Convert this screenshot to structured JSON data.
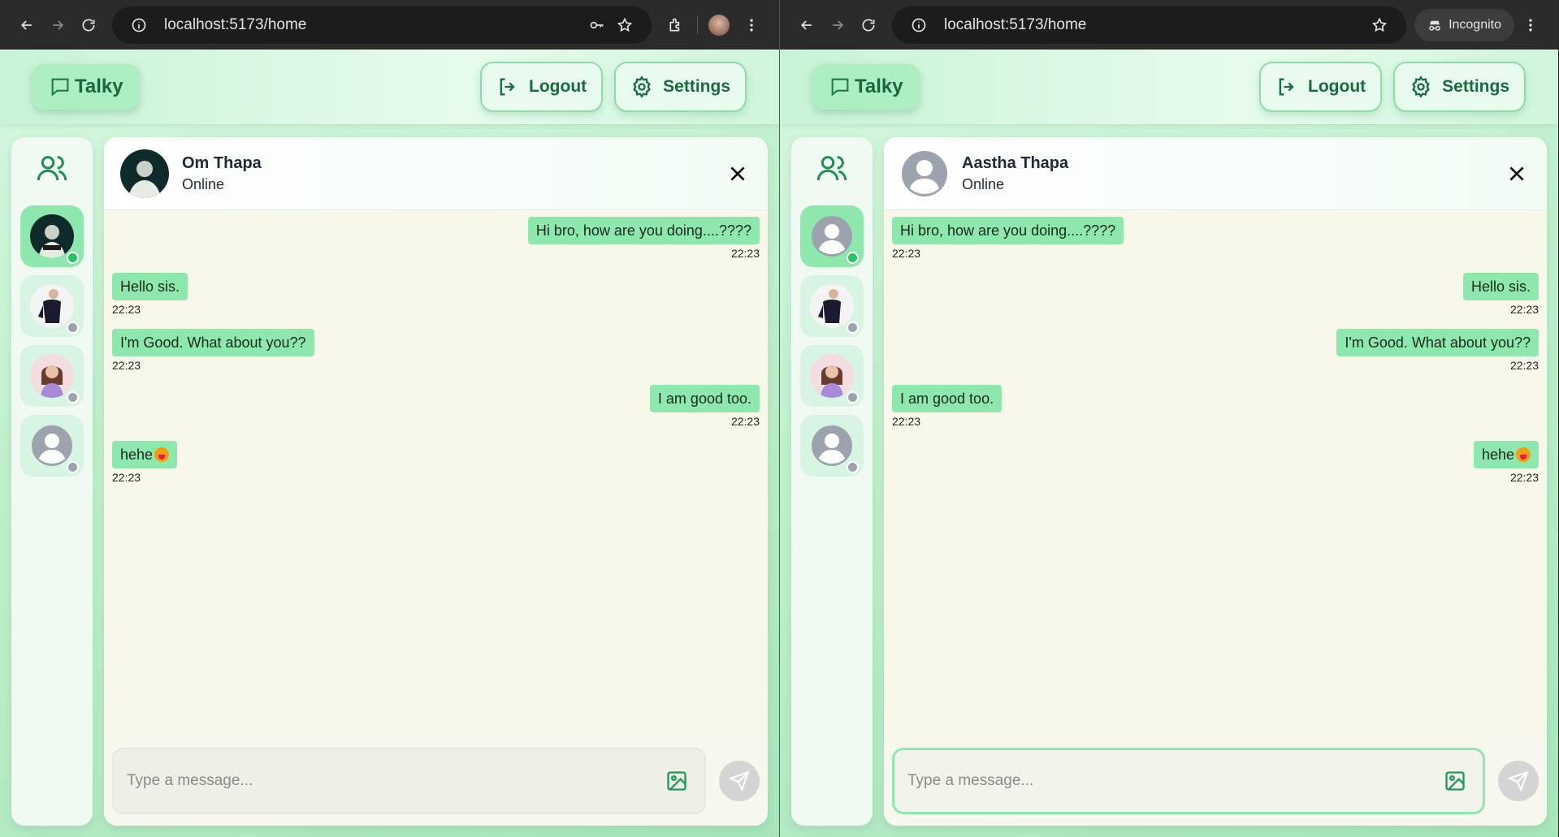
{
  "windows": [
    {
      "browser": {
        "url": "localhost:5173/home"
      },
      "app": {
        "brand": "Talky",
        "logout_label": "Logout",
        "settings_label": "Settings",
        "chat": {
          "name": "Om Thapa",
          "status": "Online"
        },
        "composer": {
          "placeholder": "Type a message..."
        },
        "messages": [
          {
            "side": "right",
            "text": "Hi bro, how are you doing....????",
            "time": "22:23"
          },
          {
            "side": "left",
            "text": "Hello sis.",
            "time": "22:23"
          },
          {
            "side": "left",
            "text": "I'm Good. What about you??",
            "time": "22:23"
          },
          {
            "side": "right",
            "text": "I am good too.",
            "time": "22:23"
          },
          {
            "side": "left",
            "text": "hehe",
            "time": "22:23",
            "emoji": true
          }
        ]
      }
    },
    {
      "browser": {
        "url": "localhost:5173/home",
        "incognito_label": "Incognito"
      },
      "app": {
        "brand": "Talky",
        "logout_label": "Logout",
        "settings_label": "Settings",
        "chat": {
          "name": "Aastha Thapa",
          "status": "Online"
        },
        "composer": {
          "placeholder": "Type a message..."
        },
        "messages": [
          {
            "side": "left",
            "text": "Hi bro, how are you doing....????",
            "time": "22:23"
          },
          {
            "side": "right",
            "text": "Hello sis.",
            "time": "22:23"
          },
          {
            "side": "right",
            "text": "I'm Good. What about you??",
            "time": "22:23"
          },
          {
            "side": "left",
            "text": "I am good too.",
            "time": "22:23"
          },
          {
            "side": "right",
            "text": "hehe",
            "time": "22:23",
            "emoji": true
          }
        ]
      }
    }
  ],
  "colors": {
    "accent": "#8ee7ad",
    "brand_text": "#166b40",
    "online": "#22c55e",
    "offline": "#9ca3af"
  }
}
